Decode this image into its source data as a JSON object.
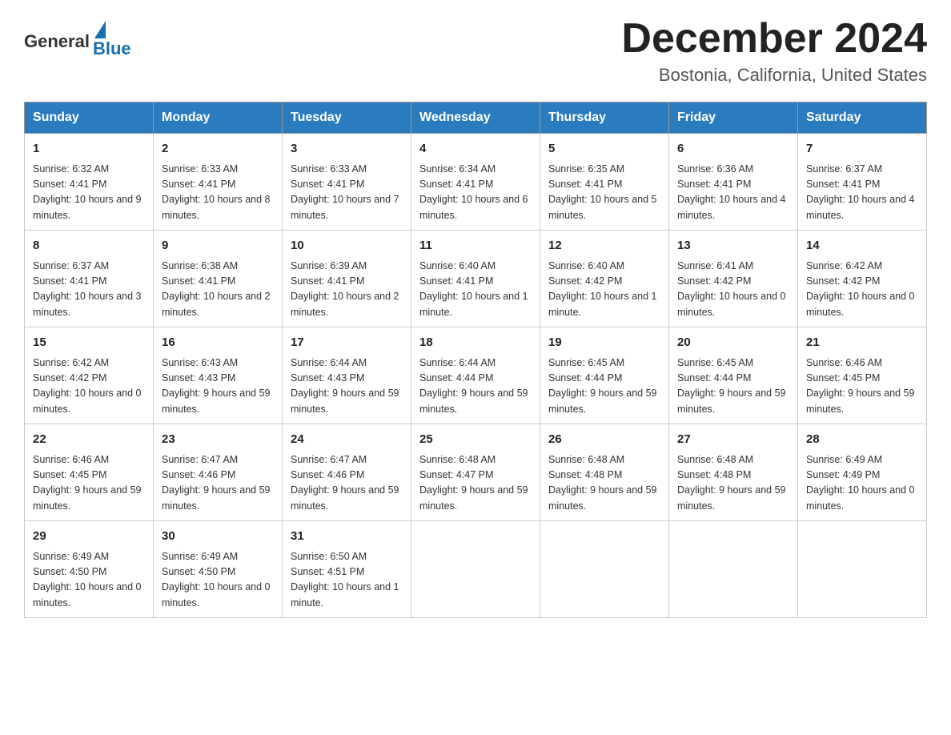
{
  "logo": {
    "general": "General",
    "blue": "Blue"
  },
  "title": "December 2024",
  "subtitle": "Bostonia, California, United States",
  "days_of_week": [
    "Sunday",
    "Monday",
    "Tuesday",
    "Wednesday",
    "Thursday",
    "Friday",
    "Saturday"
  ],
  "weeks": [
    [
      {
        "day": "1",
        "sunrise": "6:32 AM",
        "sunset": "4:41 PM",
        "daylight": "10 hours and 9 minutes."
      },
      {
        "day": "2",
        "sunrise": "6:33 AM",
        "sunset": "4:41 PM",
        "daylight": "10 hours and 8 minutes."
      },
      {
        "day": "3",
        "sunrise": "6:33 AM",
        "sunset": "4:41 PM",
        "daylight": "10 hours and 7 minutes."
      },
      {
        "day": "4",
        "sunrise": "6:34 AM",
        "sunset": "4:41 PM",
        "daylight": "10 hours and 6 minutes."
      },
      {
        "day": "5",
        "sunrise": "6:35 AM",
        "sunset": "4:41 PM",
        "daylight": "10 hours and 5 minutes."
      },
      {
        "day": "6",
        "sunrise": "6:36 AM",
        "sunset": "4:41 PM",
        "daylight": "10 hours and 4 minutes."
      },
      {
        "day": "7",
        "sunrise": "6:37 AM",
        "sunset": "4:41 PM",
        "daylight": "10 hours and 4 minutes."
      }
    ],
    [
      {
        "day": "8",
        "sunrise": "6:37 AM",
        "sunset": "4:41 PM",
        "daylight": "10 hours and 3 minutes."
      },
      {
        "day": "9",
        "sunrise": "6:38 AM",
        "sunset": "4:41 PM",
        "daylight": "10 hours and 2 minutes."
      },
      {
        "day": "10",
        "sunrise": "6:39 AM",
        "sunset": "4:41 PM",
        "daylight": "10 hours and 2 minutes."
      },
      {
        "day": "11",
        "sunrise": "6:40 AM",
        "sunset": "4:41 PM",
        "daylight": "10 hours and 1 minute."
      },
      {
        "day": "12",
        "sunrise": "6:40 AM",
        "sunset": "4:42 PM",
        "daylight": "10 hours and 1 minute."
      },
      {
        "day": "13",
        "sunrise": "6:41 AM",
        "sunset": "4:42 PM",
        "daylight": "10 hours and 0 minutes."
      },
      {
        "day": "14",
        "sunrise": "6:42 AM",
        "sunset": "4:42 PM",
        "daylight": "10 hours and 0 minutes."
      }
    ],
    [
      {
        "day": "15",
        "sunrise": "6:42 AM",
        "sunset": "4:42 PM",
        "daylight": "10 hours and 0 minutes."
      },
      {
        "day": "16",
        "sunrise": "6:43 AM",
        "sunset": "4:43 PM",
        "daylight": "9 hours and 59 minutes."
      },
      {
        "day": "17",
        "sunrise": "6:44 AM",
        "sunset": "4:43 PM",
        "daylight": "9 hours and 59 minutes."
      },
      {
        "day": "18",
        "sunrise": "6:44 AM",
        "sunset": "4:44 PM",
        "daylight": "9 hours and 59 minutes."
      },
      {
        "day": "19",
        "sunrise": "6:45 AM",
        "sunset": "4:44 PM",
        "daylight": "9 hours and 59 minutes."
      },
      {
        "day": "20",
        "sunrise": "6:45 AM",
        "sunset": "4:44 PM",
        "daylight": "9 hours and 59 minutes."
      },
      {
        "day": "21",
        "sunrise": "6:46 AM",
        "sunset": "4:45 PM",
        "daylight": "9 hours and 59 minutes."
      }
    ],
    [
      {
        "day": "22",
        "sunrise": "6:46 AM",
        "sunset": "4:45 PM",
        "daylight": "9 hours and 59 minutes."
      },
      {
        "day": "23",
        "sunrise": "6:47 AM",
        "sunset": "4:46 PM",
        "daylight": "9 hours and 59 minutes."
      },
      {
        "day": "24",
        "sunrise": "6:47 AM",
        "sunset": "4:46 PM",
        "daylight": "9 hours and 59 minutes."
      },
      {
        "day": "25",
        "sunrise": "6:48 AM",
        "sunset": "4:47 PM",
        "daylight": "9 hours and 59 minutes."
      },
      {
        "day": "26",
        "sunrise": "6:48 AM",
        "sunset": "4:48 PM",
        "daylight": "9 hours and 59 minutes."
      },
      {
        "day": "27",
        "sunrise": "6:48 AM",
        "sunset": "4:48 PM",
        "daylight": "9 hours and 59 minutes."
      },
      {
        "day": "28",
        "sunrise": "6:49 AM",
        "sunset": "4:49 PM",
        "daylight": "10 hours and 0 minutes."
      }
    ],
    [
      {
        "day": "29",
        "sunrise": "6:49 AM",
        "sunset": "4:50 PM",
        "daylight": "10 hours and 0 minutes."
      },
      {
        "day": "30",
        "sunrise": "6:49 AM",
        "sunset": "4:50 PM",
        "daylight": "10 hours and 0 minutes."
      },
      {
        "day": "31",
        "sunrise": "6:50 AM",
        "sunset": "4:51 PM",
        "daylight": "10 hours and 1 minute."
      },
      null,
      null,
      null,
      null
    ]
  ]
}
